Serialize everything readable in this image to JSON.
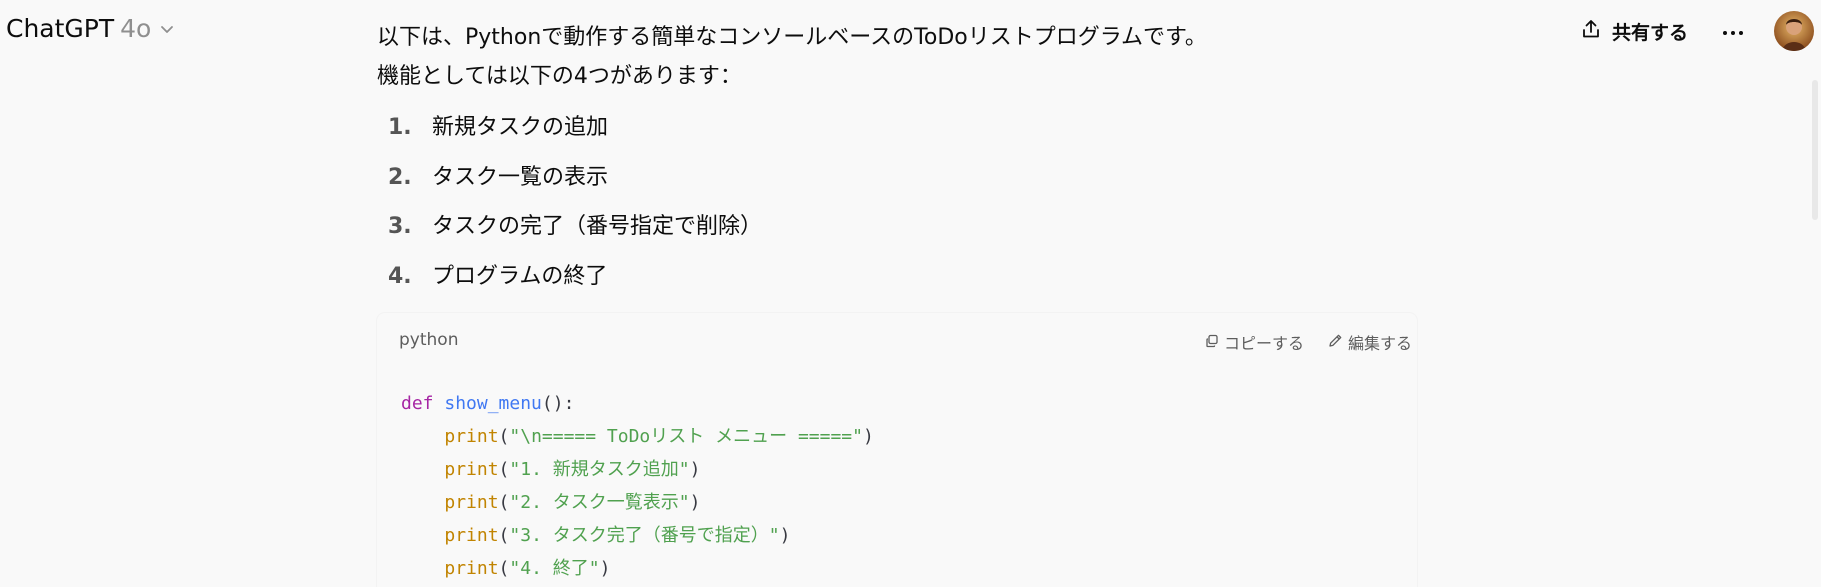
{
  "header": {
    "model_name": "ChatGPT",
    "model_version": "4o",
    "share_label": "共有する",
    "more_label": "···"
  },
  "message": {
    "intro": "以下は、Pythonで動作する簡単なコンソールベースのToDoリストプログラムです。",
    "features_intro": "機能としては以下の4つがあります：",
    "items": [
      {
        "num": "1.",
        "text": "新規タスクの追加"
      },
      {
        "num": "2.",
        "text": "タスク一覧の表示"
      },
      {
        "num": "3.",
        "text": "タスクの完了（番号指定で削除）"
      },
      {
        "num": "4.",
        "text": "プログラムの終了"
      }
    ]
  },
  "code_block": {
    "language": "python",
    "copy_label": "コピーする",
    "edit_label": "編集する",
    "lines": [
      {
        "kw": "def",
        "fn": "show_menu",
        "rest": "():"
      },
      {
        "indent": "    ",
        "builtin": "print",
        "open": "(",
        "str": "\"\\n===== ToDoリスト メニュー =====\"",
        "close": ")"
      },
      {
        "indent": "    ",
        "builtin": "print",
        "open": "(",
        "str": "\"1. 新規タスク追加\"",
        "close": ")"
      },
      {
        "indent": "    ",
        "builtin": "print",
        "open": "(",
        "str": "\"2. タスク一覧表示\"",
        "close": ")"
      },
      {
        "indent": "    ",
        "builtin": "print",
        "open": "(",
        "str": "\"3. タスク完了（番号で指定）\"",
        "close": ")"
      },
      {
        "indent": "    ",
        "builtin": "print",
        "open": "(",
        "str": "\"4. 終了\"",
        "close": ")"
      }
    ]
  },
  "colors": {
    "background": "#f9f9f9",
    "keyword": "#a626a4",
    "function": "#4078f2",
    "builtin": "#c18401",
    "string": "#50a14f"
  },
  "icons": {
    "model_dropdown": "chevron-down-icon",
    "share": "share-icon",
    "more": "more-icon",
    "copy": "copy-icon",
    "edit": "edit-icon"
  }
}
